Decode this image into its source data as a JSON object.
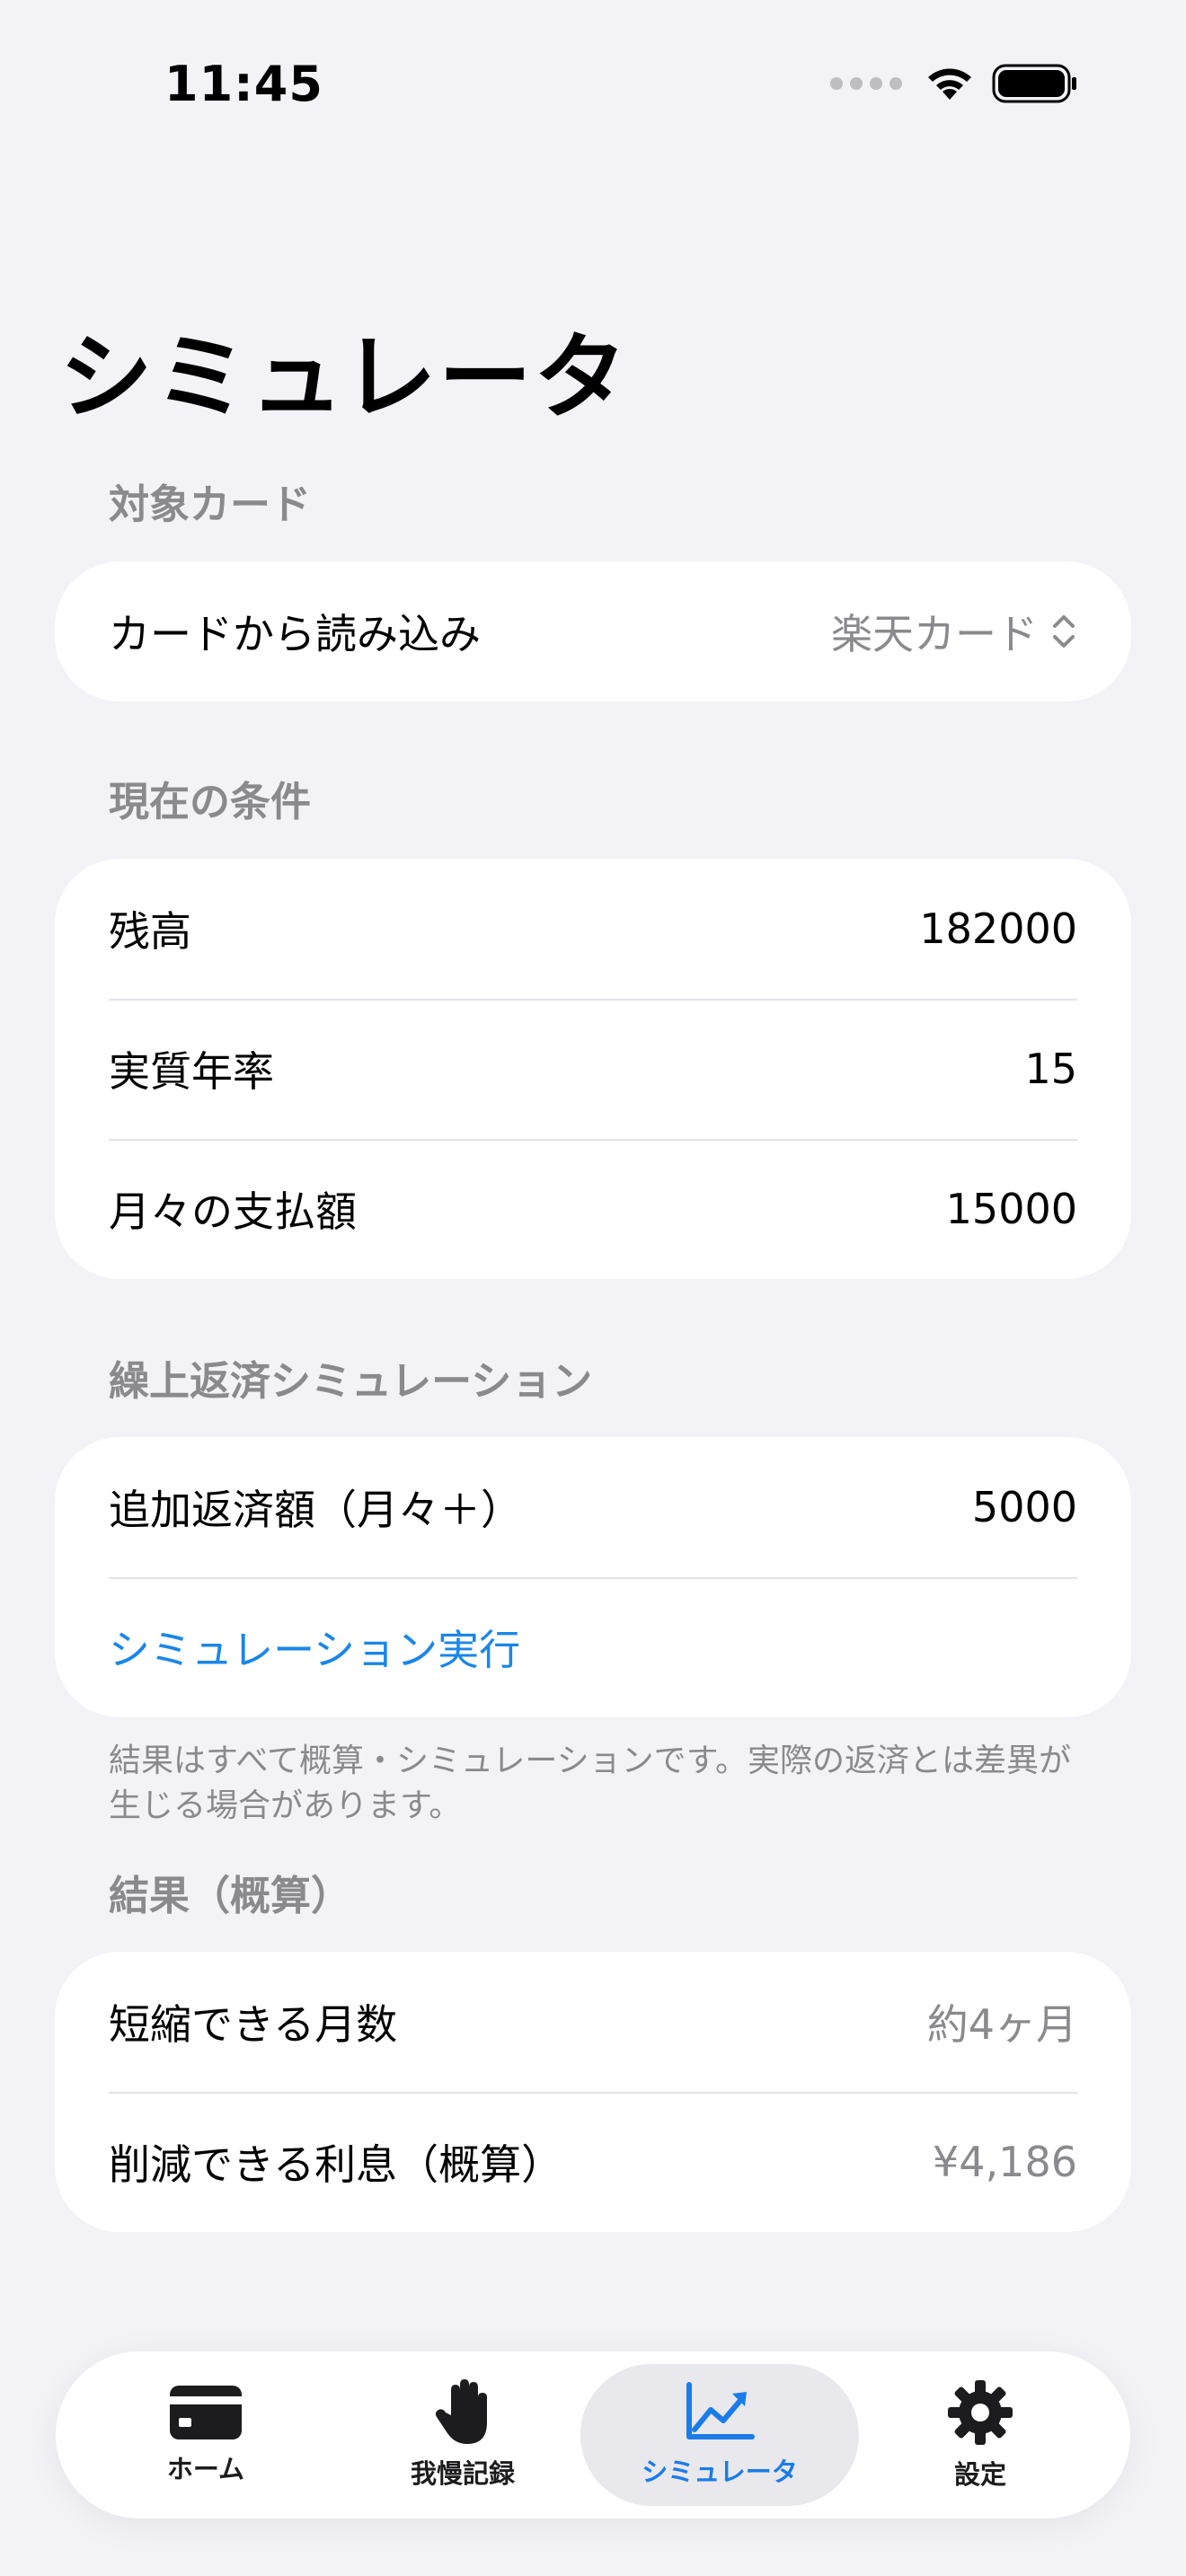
{
  "status": {
    "time": "11:45"
  },
  "title": "シミュレータ",
  "sections": {
    "target_card": {
      "header": "対象カード",
      "load_label": "カードから読み込み",
      "selected_card": "楽天カード"
    },
    "current": {
      "header": "現在の条件",
      "rows": [
        {
          "label": "残高",
          "value": "182000"
        },
        {
          "label": "実質年率",
          "value": "15"
        },
        {
          "label": "月々の支払額",
          "value": "15000"
        }
      ]
    },
    "prepayment": {
      "header": "繰上返済シミュレーション",
      "extra_label": "追加返済額（月々＋）",
      "extra_value": "5000",
      "run_button": "シミュレーション実行",
      "note": "結果はすべて概算・シミュレーションです。実際の返済とは差異が生じる場合があります。"
    },
    "result": {
      "header": "結果（概算）",
      "rows": [
        {
          "label": "短縮できる月数",
          "value": "約4ヶ月"
        },
        {
          "label": "削減できる利息（概算）",
          "value": "¥4,186"
        }
      ]
    }
  },
  "tabs": [
    {
      "label": "ホーム",
      "icon": "credit-card-icon"
    },
    {
      "label": "我慢記録",
      "icon": "hand-icon"
    },
    {
      "label": "シミュレータ",
      "icon": "chart-line-icon",
      "active": true
    },
    {
      "label": "設定",
      "icon": "gear-icon"
    }
  ],
  "colors": {
    "accent": "#1A86E8",
    "background": "#F2F2F7",
    "muted": "#8A8A8E"
  }
}
